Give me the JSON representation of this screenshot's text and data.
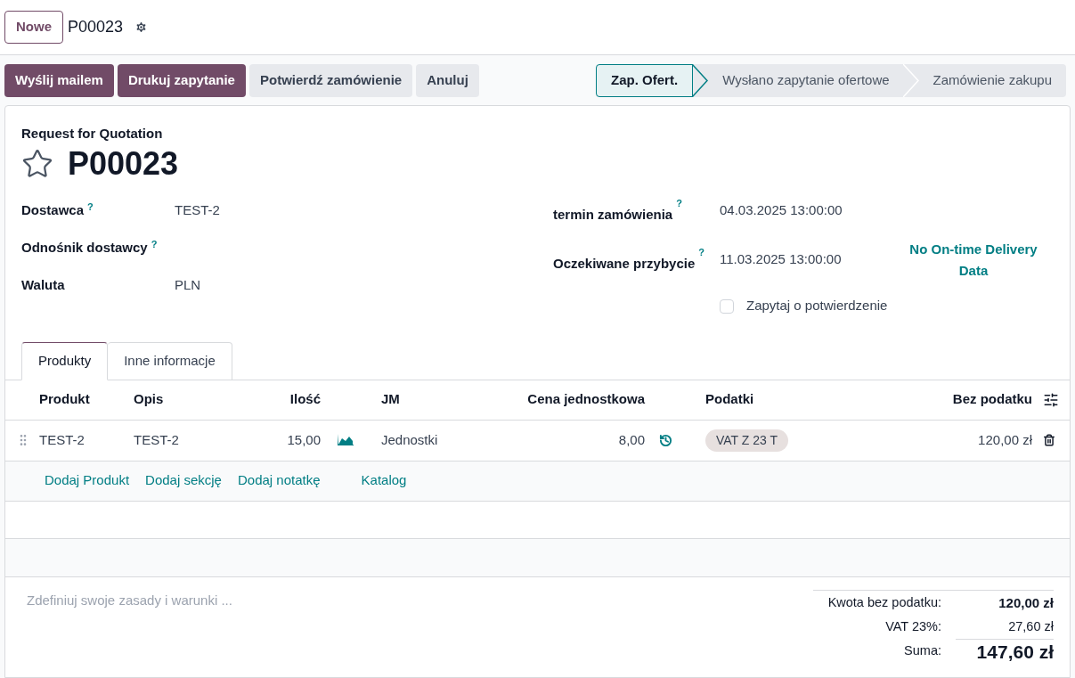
{
  "breadcrumb": {
    "new_button": "Nowe",
    "record": "P00023"
  },
  "actions": [
    {
      "label": "Wyślij mailem",
      "primary": true
    },
    {
      "label": "Drukuj zapytanie",
      "primary": true
    },
    {
      "label": "Potwierdź zamówienie",
      "primary": false
    },
    {
      "label": "Anuluj",
      "primary": false
    }
  ],
  "stages": [
    {
      "label": "Zap. Ofert.",
      "selected": true
    },
    {
      "label": "Wysłano zapytanie ofertowe",
      "selected": false
    },
    {
      "label": "Zamówienie zakupu",
      "selected": false
    }
  ],
  "form": {
    "subtitle": "Request for Quotation",
    "title": "P00023",
    "starred": false,
    "left_fields": [
      {
        "label": "Dostawca",
        "help": "?",
        "value": "TEST-2"
      },
      {
        "label": "Odnośnik dostawcy",
        "help": "?"
      },
      {
        "label": "Waluta",
        "value": "PLN"
      }
    ],
    "right_fields": [
      {
        "label": "termin zamówienia",
        "help": "?",
        "value": "04.03.2025 13:00:00"
      },
      {
        "label": "Oczekiwane przybycie",
        "help": "?",
        "value": "11.03.2025 13:00:00",
        "note": "No On-time Delivery Data"
      }
    ],
    "confirm_checkbox": {
      "label": "Zapytaj o potwierdzenie",
      "checked": false
    }
  },
  "tabs": [
    {
      "label": "Produkty",
      "selected": true
    },
    {
      "label": "Inne informacje",
      "selected": false
    }
  ],
  "table": {
    "columns": [
      "Produkt",
      "Opis",
      "Ilość",
      "JM",
      "Cena jednostkowa",
      "Podatki",
      "Bez podatku"
    ],
    "rows": [
      {
        "product": "TEST-2",
        "description": "TEST-2",
        "quantity": "15,00",
        "unit": "Jednostki",
        "unit_price": "8,00",
        "tax": "VAT Z 23 T",
        "subtotal": "120,00 zł"
      }
    ],
    "add_links": [
      "Dodaj Produkt",
      "Dodaj sekcję",
      "Dodaj notatkę",
      "Katalog"
    ]
  },
  "terms": {
    "placeholder": "Zdefiniuj swoje zasady i warunki ..."
  },
  "totals": [
    {
      "label": "Kwota bez podatku:",
      "value": "120,00 zł",
      "kind": "untaxed"
    },
    {
      "label": "VAT 23%:",
      "value": "27,60 zł",
      "kind": "tax"
    },
    {
      "label": "Suma:",
      "value": "147,60 zł",
      "kind": "total"
    }
  ]
}
